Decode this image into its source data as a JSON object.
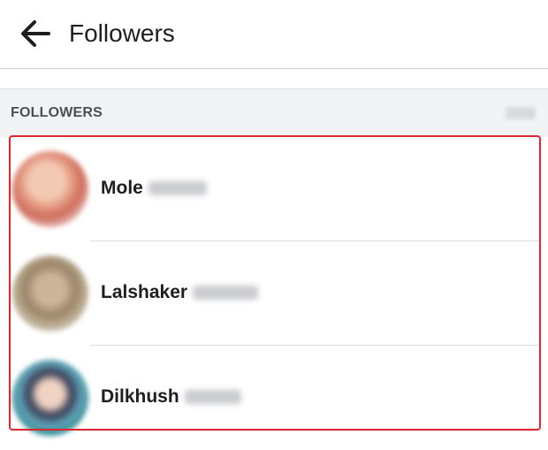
{
  "header": {
    "title": "Followers",
    "back_icon": "arrow-left-icon"
  },
  "section": {
    "label": "FOLLOWERS"
  },
  "followers": [
    {
      "name": "Mole"
    },
    {
      "name": "Lalshaker"
    },
    {
      "name": "Dilkhush"
    }
  ],
  "colors": {
    "highlight": "#e0262d",
    "section_bg": "#f2f3f5"
  }
}
